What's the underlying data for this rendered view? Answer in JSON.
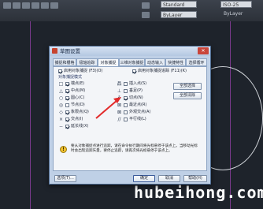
{
  "app": {
    "toolbar": {
      "style_combo": "Standard",
      "dim_combo": "ISO-25",
      "layer_combo": "ByLayer",
      "linetype_combo": "ByLayer",
      "text_label": "ByLayer"
    },
    "watermark": "hubeihong.com"
  },
  "dialog": {
    "title": "草图设置",
    "close_label": "✕",
    "tabs": [
      {
        "label": "捕捉和栅格"
      },
      {
        "label": "极轴追踪"
      },
      {
        "label": "对象捕捉"
      },
      {
        "label": "三维对象捕捉"
      },
      {
        "label": "动态输入"
      },
      {
        "label": "快捷特性"
      },
      {
        "label": "选择循环"
      }
    ],
    "snap_on": {
      "label": "启用对象捕捉 (F3)(O)",
      "checked": true
    },
    "tracking_on": {
      "label": "启用对象捕捉追踪 (F11)(K)",
      "checked": true
    },
    "group_label": "对象捕捉模式",
    "left_modes": [
      {
        "symbol": "□",
        "label": "端点(E)",
        "checked": true
      },
      {
        "symbol": "△",
        "label": "中点(M)",
        "checked": true
      },
      {
        "symbol": "○",
        "label": "圆心(C)",
        "checked": true
      },
      {
        "symbol": "◎",
        "label": "节点(D)",
        "checked": false
      },
      {
        "symbol": "◇",
        "label": "象限点(Q)",
        "checked": true
      },
      {
        "symbol": "×",
        "label": "交点(I)",
        "checked": true
      },
      {
        "symbol": "--",
        "label": "延长线(X)",
        "checked": true
      }
    ],
    "right_modes": [
      {
        "symbol": "品",
        "label": "插入点(S)",
        "checked": false
      },
      {
        "symbol": "⊥",
        "label": "垂足(P)",
        "checked": false
      },
      {
        "symbol": "ō",
        "label": "切点(N)",
        "checked": true
      },
      {
        "symbol": "⊠",
        "label": "最近点(R)",
        "checked": false
      },
      {
        "symbol": "⊠",
        "label": "外观交点(A)",
        "checked": false
      },
      {
        "symbol": "//",
        "label": "平行线(L)",
        "checked": false
      }
    ],
    "select_all_label": "全部选择",
    "clear_all_label": "全部清除",
    "note_icon": "!",
    "note_text": "要从对象捕捉点进行追踪，请在命令执行期间将光标悬停于该点上。当移动光标时会出现追踪矢量，要停止追踪，请再次将光标悬停于该点上。",
    "options_label": "选项(T)...",
    "ok_label": "确定",
    "cancel_label": "取消",
    "help_label": "帮助(H)"
  }
}
